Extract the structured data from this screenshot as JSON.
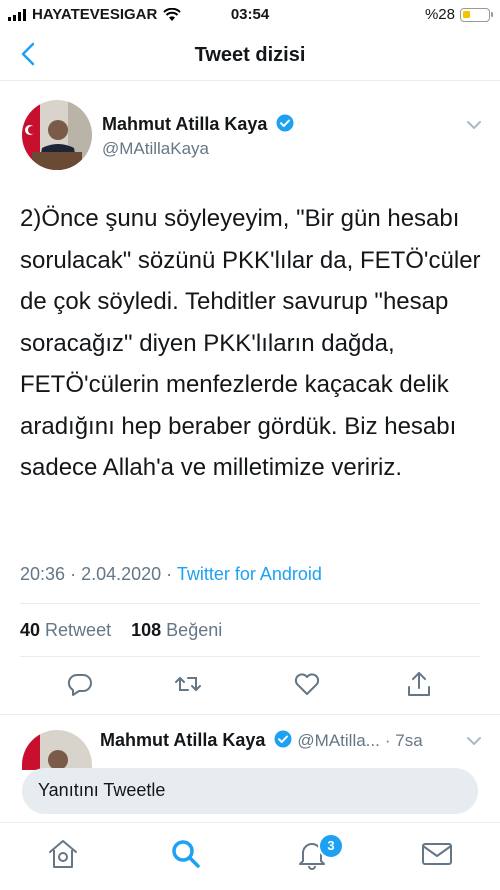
{
  "status_bar": {
    "carrier": "HAYATEVESIGAR",
    "time": "03:54",
    "battery": "%28"
  },
  "header": {
    "title": "Tweet dizisi"
  },
  "tweet": {
    "author_name": "Mahmut Atilla Kaya",
    "author_handle": "@MAtillaKaya",
    "text": "2)Önce şunu söyleyeyim, \"Bir gün hesabı sorulacak\" sözünü PKK'lılar da, FETÖ'cüler de çok söyledi. Tehditler savurup \"hesap soracağız\" diyen PKK'lıların dağda, FETÖ'cülerin menfezlerde kaçacak delik aradığını hep beraber gördük. Biz hesabı sadece Allah'a ve milletimize veririz.",
    "time": "20:36",
    "date": "2.04.2020",
    "client": "Twitter for Android",
    "retweets": "40",
    "retweets_label": "Retweet",
    "likes": "108",
    "likes_label": "Beğeni"
  },
  "next_tweet": {
    "author_name": "Mahmut Atilla Kaya",
    "author_handle": "@MAtilla...",
    "age": "· 7sa"
  },
  "reply": {
    "placeholder": "Yanıtını Tweetle"
  },
  "tabbar": {
    "notification_count": "3"
  },
  "colors": {
    "accent": "#1da1f2",
    "secondary_text": "#657786",
    "divider": "#e6ecf0"
  }
}
